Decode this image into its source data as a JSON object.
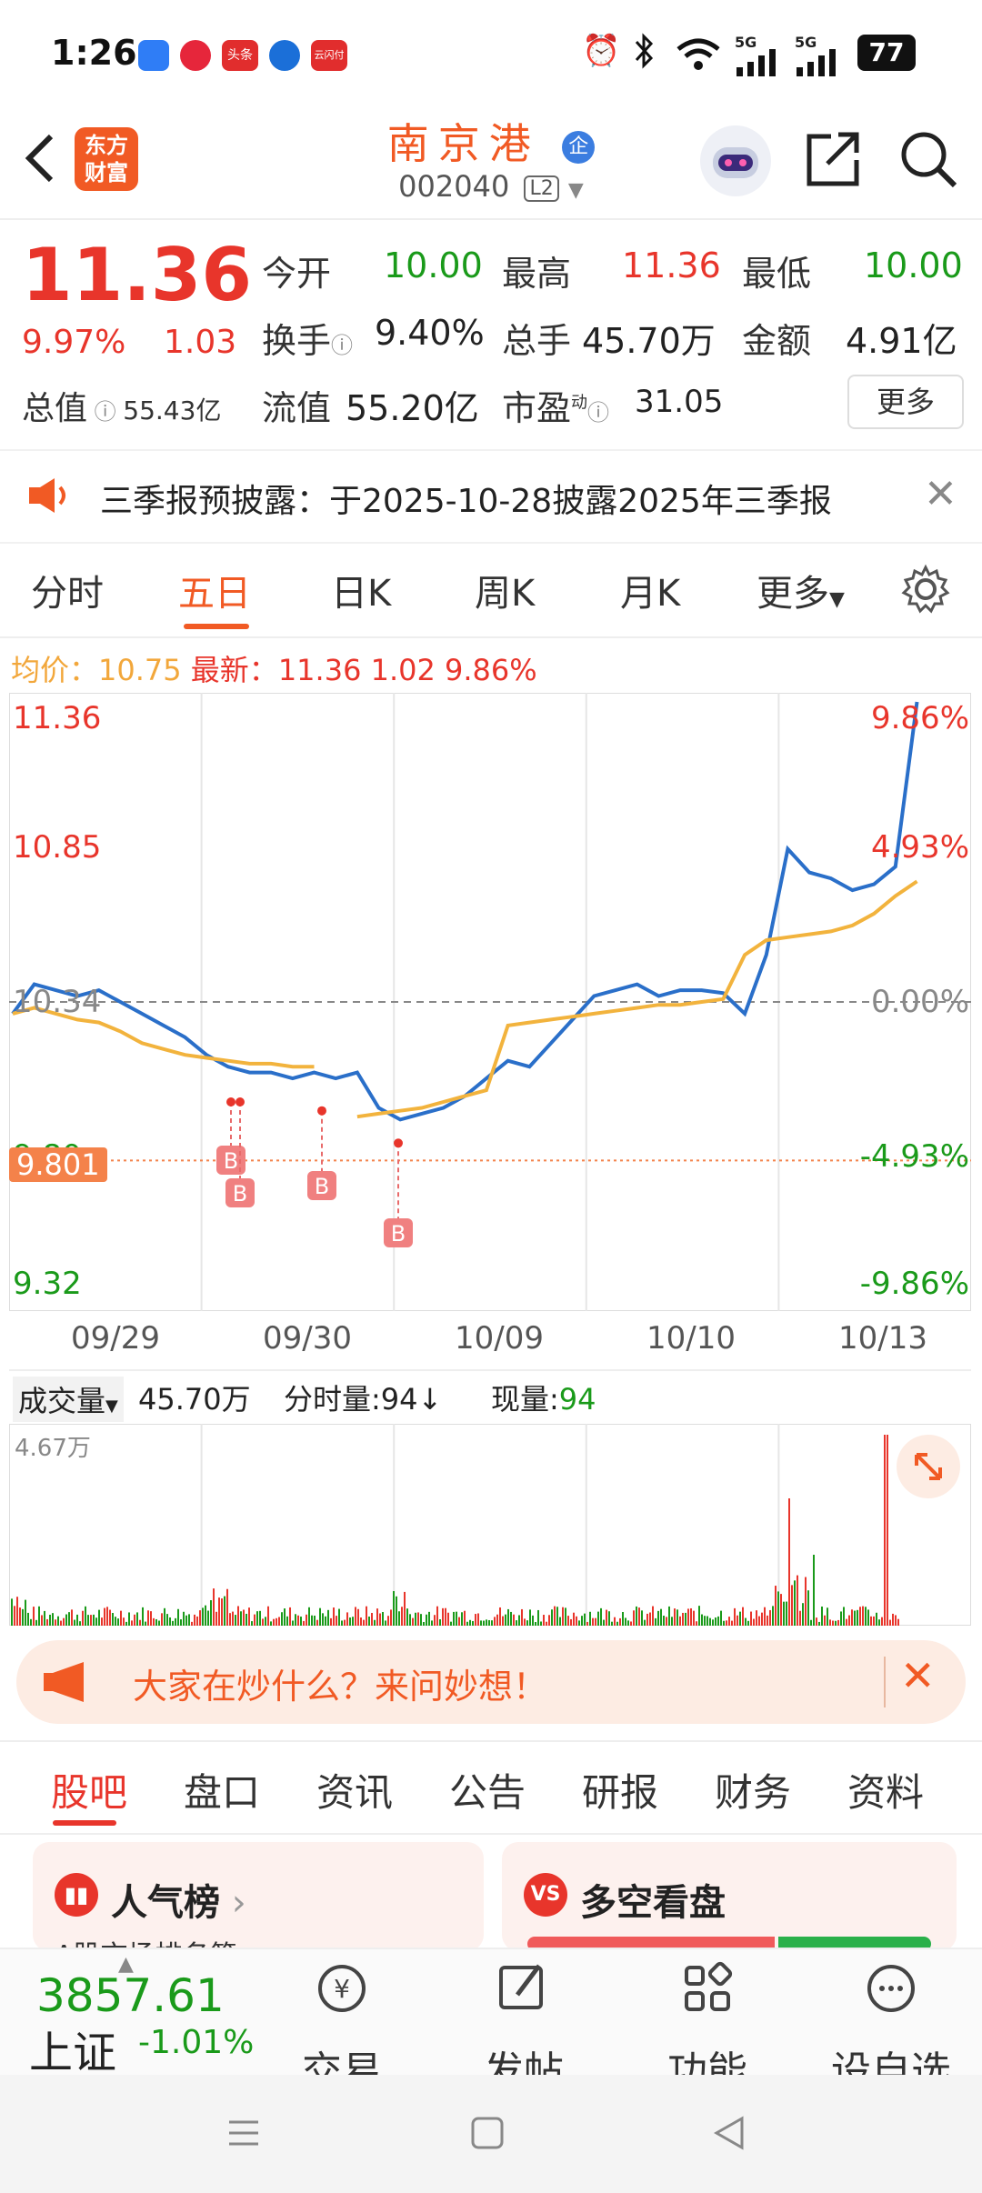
{
  "status_bar": {
    "time": "1:26",
    "network": "5G",
    "network2": "5G",
    "battery": "77",
    "app_icons": [
      {
        "name": "app-icon-1",
        "color": "#2f7df6",
        "label": ""
      },
      {
        "name": "app-icon-2",
        "color": "#e6263b",
        "label": ""
      },
      {
        "name": "toutiao-icon",
        "color": "#e12d2d",
        "label": "头条"
      },
      {
        "name": "app-icon-4",
        "color": "#1b6fd8",
        "label": ""
      },
      {
        "name": "app-icon-5",
        "color": "#e12d2d",
        "label": "云闪付"
      }
    ]
  },
  "header": {
    "logo_line1": "东方",
    "logo_line2": "财富",
    "stock_name": "南京港",
    "badge": "企",
    "stock_code": "002040",
    "level": "L2"
  },
  "quote": {
    "price": "11.36",
    "change_pct": "9.97%",
    "change": "1.03",
    "open_label": "今开",
    "open": "10.00",
    "high_label": "最高",
    "high": "11.36",
    "low_label": "最低",
    "low": "10.00",
    "turnover_label": "换手",
    "turnover": "9.40%",
    "volume_label": "总手",
    "volume": "45.70万",
    "amount_label": "金额",
    "amount": "4.91亿",
    "mktcap_label": "总值",
    "mktcap": "55.43亿",
    "float_label": "流值",
    "float": "55.20亿",
    "pe_label": "市盈",
    "pe_sup": "动",
    "pe": "31.05",
    "more": "更多"
  },
  "notice": {
    "text": "三季报预披露：于2025-10-28披露2025年三季报"
  },
  "tabs": [
    "分时",
    "五日",
    "日K",
    "周K",
    "月K",
    "更多"
  ],
  "tabs_active": 1,
  "chart_info": {
    "avg_label": "均价：",
    "avg": "10.75",
    "latest_label": "最新：",
    "latest": "11.36",
    "change": "1.02",
    "pct": "9.86%"
  },
  "chart_data": {
    "type": "line",
    "x": [
      "09/29",
      "09/30",
      "10/09",
      "10/10",
      "10/13"
    ],
    "y_ticks_left": [
      "11.36",
      "10.85",
      "10.34",
      "9.80",
      "9.32"
    ],
    "y_ticks_right": [
      "9.86%",
      "4.93%",
      "0.00%",
      "-4.93%",
      "-9.86%"
    ],
    "ylim": [
      9.32,
      11.36
    ],
    "prev_close": 10.34,
    "marker_price": "9.801",
    "series": [
      {
        "name": "price",
        "color": "#2a6fc9",
        "values": [
          10.3,
          10.4,
          10.38,
          10.36,
          10.38,
          10.34,
          10.3,
          10.26,
          10.22,
          10.16,
          10.12,
          10.1,
          10.1,
          10.08,
          10.1,
          10.08,
          10.1,
          9.98,
          9.94,
          9.96,
          9.98,
          10.02,
          10.08,
          10.14,
          10.12,
          10.2,
          10.28,
          10.36,
          10.38,
          10.4,
          10.36,
          10.38,
          10.38,
          10.37,
          10.3,
          10.5,
          10.86,
          10.78,
          10.76,
          10.72,
          10.74,
          10.8,
          11.36
        ]
      },
      {
        "name": "avg",
        "color": "#f2b33d",
        "values": [
          10.3,
          10.32,
          10.3,
          10.28,
          10.27,
          10.24,
          10.2,
          10.18,
          10.16,
          10.15,
          10.14,
          10.13,
          10.13,
          10.12,
          10.12,
          null,
          9.95,
          9.96,
          9.97,
          9.98,
          10.0,
          10.02,
          10.04,
          10.26,
          10.27,
          10.28,
          10.29,
          10.3,
          10.31,
          10.32,
          10.33,
          10.33,
          10.34,
          10.35,
          10.5,
          10.55,
          10.56,
          10.57,
          10.58,
          10.6,
          10.64,
          10.7,
          10.75
        ]
      }
    ],
    "buy_markers": [
      "B",
      "B",
      "B",
      "B"
    ]
  },
  "volume": {
    "label": "成交量",
    "total": "45.70万",
    "tick_label": "分时量:94↓",
    "now_label": "现量:",
    "now": "94",
    "max": "4.67万"
  },
  "ask_banner": {
    "text": "大家在炒什么？来问妙想！"
  },
  "sub_tabs": [
    "股吧",
    "盘口",
    "资讯",
    "公告",
    "研报",
    "财务",
    "资料"
  ],
  "sub_tabs_active": 0,
  "cards": {
    "popular": "人气榜",
    "popular_sub": "A股市场排名第",
    "debate": "多空看盘"
  },
  "bottom": {
    "index_value": "3857.61",
    "index_name": "上证",
    "index_change": "-1.01%",
    "trade": "交易",
    "post": "发帖",
    "func": "功能",
    "watch": "设自选"
  }
}
